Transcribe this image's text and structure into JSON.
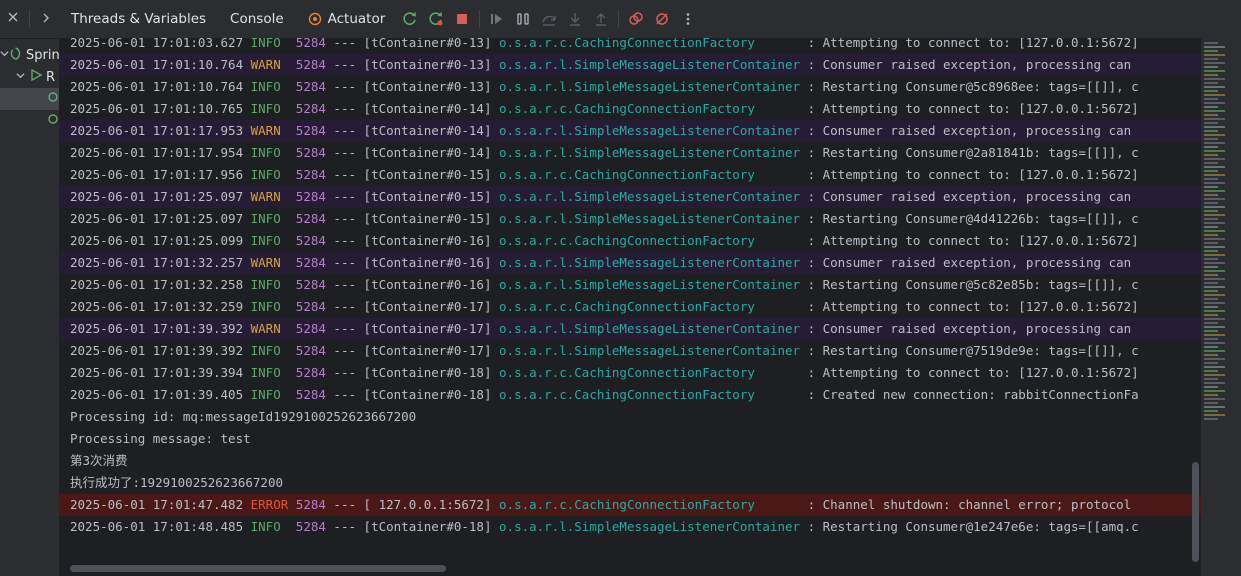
{
  "sidebar": {
    "collapse_icon": "collapse-all-icon",
    "expand_icon": "chevron-right-icon",
    "items": [
      {
        "label": "Sprin"
      },
      {
        "label": "R"
      }
    ]
  },
  "toolbar": {
    "tabs": [
      "Threads & Variables",
      "Console",
      "Actuator"
    ],
    "icons": [
      "rerun-icon",
      "rerun-failed-icon",
      "stop-icon",
      "resume-icon",
      "pause-icon",
      "step-over-icon",
      "step-into-icon",
      "step-out-icon",
      "view-breakpoints-icon",
      "mute-breakpoints-icon",
      "more-icon"
    ]
  },
  "colors": {
    "info": "#5fa66b",
    "warn": "#d5a142",
    "error": "#e0533c",
    "logger": "#2aaaa2",
    "pid": "#b57fc9"
  },
  "console": {
    "lines": [
      {
        "kind": "log",
        "date": "2025-06-01 17:01:03.627",
        "level": "INFO ",
        "pid": "5284",
        "sep": " --- ",
        "thread": "[tContainer#0-13]",
        "logger": "o.s.a.r.c.CachingConnectionFactory      ",
        "msg": " : Attempting to connect to: [127.0.0.1:5672]"
      },
      {
        "kind": "log",
        "date": "2025-06-01 17:01:10.764",
        "level": "WARN ",
        "pid": "5284",
        "sep": " --- ",
        "thread": "[tContainer#0-13]",
        "logger": "o.s.a.r.l.SimpleMessageListenerContainer",
        "msg": " : Consumer raised exception, processing can"
      },
      {
        "kind": "log",
        "date": "2025-06-01 17:01:10.764",
        "level": "INFO ",
        "pid": "5284",
        "sep": " --- ",
        "thread": "[tContainer#0-13]",
        "logger": "o.s.a.r.l.SimpleMessageListenerContainer",
        "msg": " : Restarting Consumer@5c8968ee: tags=[[]], c"
      },
      {
        "kind": "log",
        "date": "2025-06-01 17:01:10.765",
        "level": "INFO ",
        "pid": "5284",
        "sep": " --- ",
        "thread": "[tContainer#0-14]",
        "logger": "o.s.a.r.c.CachingConnectionFactory      ",
        "msg": " : Attempting to connect to: [127.0.0.1:5672]"
      },
      {
        "kind": "log",
        "date": "2025-06-01 17:01:17.953",
        "level": "WARN ",
        "pid": "5284",
        "sep": " --- ",
        "thread": "[tContainer#0-14]",
        "logger": "o.s.a.r.l.SimpleMessageListenerContainer",
        "msg": " : Consumer raised exception, processing can"
      },
      {
        "kind": "log",
        "date": "2025-06-01 17:01:17.954",
        "level": "INFO ",
        "pid": "5284",
        "sep": " --- ",
        "thread": "[tContainer#0-14]",
        "logger": "o.s.a.r.l.SimpleMessageListenerContainer",
        "msg": " : Restarting Consumer@2a81841b: tags=[[]], c"
      },
      {
        "kind": "log",
        "date": "2025-06-01 17:01:17.956",
        "level": "INFO ",
        "pid": "5284",
        "sep": " --- ",
        "thread": "[tContainer#0-15]",
        "logger": "o.s.a.r.c.CachingConnectionFactory      ",
        "msg": " : Attempting to connect to: [127.0.0.1:5672]"
      },
      {
        "kind": "log",
        "date": "2025-06-01 17:01:25.097",
        "level": "WARN ",
        "pid": "5284",
        "sep": " --- ",
        "thread": "[tContainer#0-15]",
        "logger": "o.s.a.r.l.SimpleMessageListenerContainer",
        "msg": " : Consumer raised exception, processing can"
      },
      {
        "kind": "log",
        "date": "2025-06-01 17:01:25.097",
        "level": "INFO ",
        "pid": "5284",
        "sep": " --- ",
        "thread": "[tContainer#0-15]",
        "logger": "o.s.a.r.l.SimpleMessageListenerContainer",
        "msg": " : Restarting Consumer@4d41226b: tags=[[]], c"
      },
      {
        "kind": "log",
        "date": "2025-06-01 17:01:25.099",
        "level": "INFO ",
        "pid": "5284",
        "sep": " --- ",
        "thread": "[tContainer#0-16]",
        "logger": "o.s.a.r.c.CachingConnectionFactory      ",
        "msg": " : Attempting to connect to: [127.0.0.1:5672]"
      },
      {
        "kind": "log",
        "date": "2025-06-01 17:01:32.257",
        "level": "WARN ",
        "pid": "5284",
        "sep": " --- ",
        "thread": "[tContainer#0-16]",
        "logger": "o.s.a.r.l.SimpleMessageListenerContainer",
        "msg": " : Consumer raised exception, processing can"
      },
      {
        "kind": "log",
        "date": "2025-06-01 17:01:32.258",
        "level": "INFO ",
        "pid": "5284",
        "sep": " --- ",
        "thread": "[tContainer#0-16]",
        "logger": "o.s.a.r.l.SimpleMessageListenerContainer",
        "msg": " : Restarting Consumer@5c82e85b: tags=[[]], c"
      },
      {
        "kind": "log",
        "date": "2025-06-01 17:01:32.259",
        "level": "INFO ",
        "pid": "5284",
        "sep": " --- ",
        "thread": "[tContainer#0-17]",
        "logger": "o.s.a.r.c.CachingConnectionFactory      ",
        "msg": " : Attempting to connect to: [127.0.0.1:5672]"
      },
      {
        "kind": "log",
        "date": "2025-06-01 17:01:39.392",
        "level": "WARN ",
        "pid": "5284",
        "sep": " --- ",
        "thread": "[tContainer#0-17]",
        "logger": "o.s.a.r.l.SimpleMessageListenerContainer",
        "msg": " : Consumer raised exception, processing can"
      },
      {
        "kind": "log",
        "date": "2025-06-01 17:01:39.392",
        "level": "INFO ",
        "pid": "5284",
        "sep": " --- ",
        "thread": "[tContainer#0-17]",
        "logger": "o.s.a.r.l.SimpleMessageListenerContainer",
        "msg": " : Restarting Consumer@7519de9e: tags=[[]], c"
      },
      {
        "kind": "log",
        "date": "2025-06-01 17:01:39.394",
        "level": "INFO ",
        "pid": "5284",
        "sep": " --- ",
        "thread": "[tContainer#0-18]",
        "logger": "o.s.a.r.c.CachingConnectionFactory      ",
        "msg": " : Attempting to connect to: [127.0.0.1:5672]"
      },
      {
        "kind": "log",
        "date": "2025-06-01 17:01:39.405",
        "level": "INFO ",
        "pid": "5284",
        "sep": " --- ",
        "thread": "[tContainer#0-18]",
        "logger": "o.s.a.r.c.CachingConnectionFactory      ",
        "msg": " : Created new connection: rabbitConnectionFa"
      },
      {
        "kind": "plain",
        "text": "Processing id: mq:messageId1929100252623667200"
      },
      {
        "kind": "plain",
        "text": "Processing message: test"
      },
      {
        "kind": "plain",
        "text": "第3次消费"
      },
      {
        "kind": "plain",
        "text": "执行成功了:1929100252623667200"
      },
      {
        "kind": "log",
        "date": "2025-06-01 17:01:47.482",
        "level": "ERROR",
        "pid": "5284",
        "sep": " --- ",
        "thread": "[ 127.0.0.1:5672]",
        "logger": "o.s.a.r.c.CachingConnectionFactory      ",
        "msg": " : Channel shutdown: channel error; protocol"
      },
      {
        "kind": "log",
        "date": "2025-06-01 17:01:48.485",
        "level": "INFO ",
        "pid": "5284",
        "sep": " --- ",
        "thread": "[tContainer#0-18]",
        "logger": "o.s.a.r.l.SimpleMessageListenerContainer",
        "msg": " : Restarting Consumer@1e247e6e: tags=[[amq.c"
      }
    ]
  }
}
